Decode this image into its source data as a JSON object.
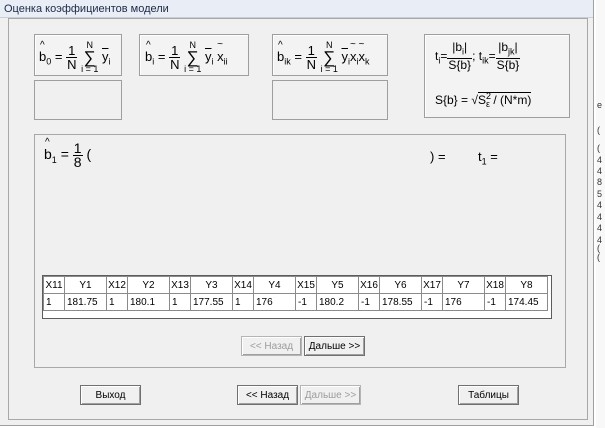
{
  "window": {
    "title": "Оценка коэффициентов модели"
  },
  "formulas": {
    "b0": {
      "lhs": "b",
      "sub": "0",
      "num": "1",
      "den": "N",
      "sum_top": "N",
      "sum_bot": "i = 1",
      "term": "y",
      "term_sub": "i"
    },
    "bi": {
      "lhs": "b",
      "sub": "i",
      "num": "1",
      "den": "N",
      "sum_top": "N",
      "sum_bot": "i = 1",
      "term": "y",
      "term_sub": "i",
      "x": "x",
      "x_sub": "ii"
    },
    "bik": {
      "lhs": "b",
      "sub": "ik",
      "num": "1",
      "den": "N",
      "sum_top": "N",
      "sum_bot": "i = 1",
      "term": "y",
      "term_sub": "i",
      "x1": "x",
      "x1_sub": "i",
      "x2": "x",
      "x2_sub": "k"
    },
    "t": {
      "t_i": "t",
      "t_i_sub": "i",
      "t_i_num": "|b",
      "t_i_num_sub": "i",
      "t_i_num_end": "|",
      "t_i_den": "S{b}",
      "sep": ";",
      "t_ik": "t",
      "t_ik_sub": "ik",
      "t_ik_num": "|b",
      "t_ik_num_sub": "jk",
      "t_ik_num_end": "|",
      "t_ik_den": "S{b}"
    },
    "s": {
      "lhs": "S{b} = ",
      "root": "√",
      "inner": "S",
      "inner_sup": "2",
      "inner_sub": "ε",
      "rest": " / (N*m)"
    }
  },
  "calc": {
    "lhs": "b",
    "lhs_sub": "1",
    "eq": "=",
    "num": "1",
    "den": "8",
    "open": "(",
    "close": ") =",
    "t_label": "t",
    "t_sub": "1",
    "t_eq": "="
  },
  "table": {
    "headers": [
      "X11",
      "Y1",
      "X12",
      "Y2",
      "X13",
      "Y3",
      "X14",
      "Y4",
      "X15",
      "Y5",
      "X16",
      "Y6",
      "X17",
      "Y7",
      "X18",
      "Y8"
    ],
    "row": [
      "1",
      "181.75",
      "1",
      "180.1",
      "1",
      "177.55",
      "1",
      "176",
      "-1",
      "180.2",
      "-1",
      "178.55",
      "-1",
      "176",
      "-1",
      "174.45"
    ]
  },
  "inner_nav": {
    "back": "<< Назад",
    "next": "Дальше >>"
  },
  "bottom": {
    "exit": "Выход",
    "back": "<< Назад",
    "next": "Дальше >>",
    "tables": "Таблицы"
  },
  "side_chars": [
    "e",
    "(",
    "(",
    "4",
    "4",
    "8",
    "5",
    "4",
    "4",
    "4",
    "4",
    "(",
    "("
  ]
}
